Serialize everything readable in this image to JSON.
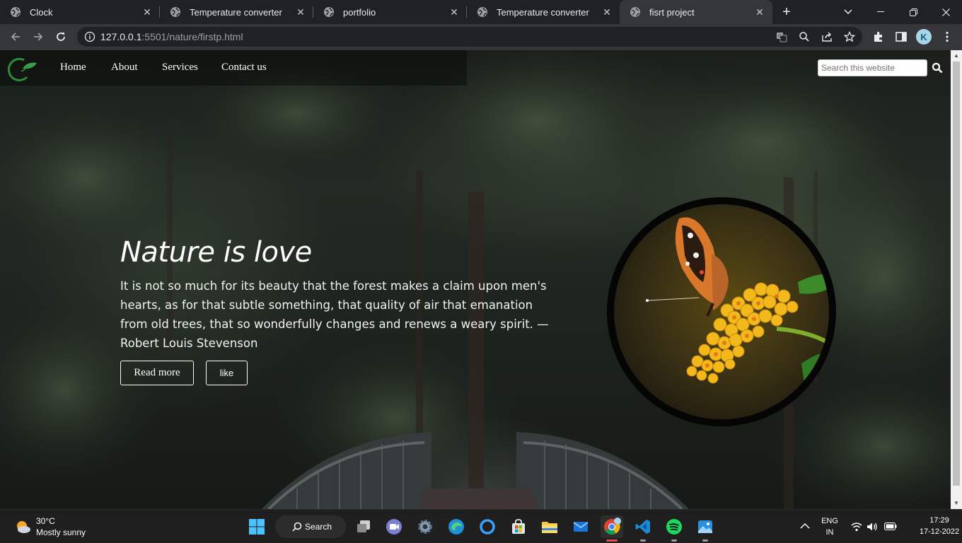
{
  "browser": {
    "tabs": [
      {
        "title": "Clock",
        "active": false
      },
      {
        "title": "Temperature converter",
        "active": false
      },
      {
        "title": "portfolio",
        "active": false
      },
      {
        "title": "Temperature converter",
        "active": false
      },
      {
        "title": "fisrt project",
        "active": true
      }
    ],
    "url_host": "127.0.0.1",
    "url_rest": ":5501/nature/firstp.html",
    "profile_initial": "K"
  },
  "site": {
    "nav": [
      "Home",
      "About",
      "Services",
      "Contact us"
    ],
    "search_placeholder": "Search this website",
    "hero_title": "Nature is love",
    "hero_text": "It is not so much for its beauty that the forest makes a claim upon men's hearts, as for that subtle something, that quality of air that emanation from old trees, that so wonderfully changes and renews a weary spirit. —Robert Louis Stevenson",
    "read_more": "Read more",
    "like": "like"
  },
  "taskbar": {
    "temperature": "30°C",
    "weather": "Mostly sunny",
    "search_label": "Search",
    "lang_top": "ENG",
    "lang_bottom": "IN",
    "time": "17:29",
    "date": "17-12-2022"
  },
  "colors": {
    "accent_green": "#2e8b3a",
    "flower_yellow": "#f2b81c",
    "chrome_dark": "#202124"
  }
}
